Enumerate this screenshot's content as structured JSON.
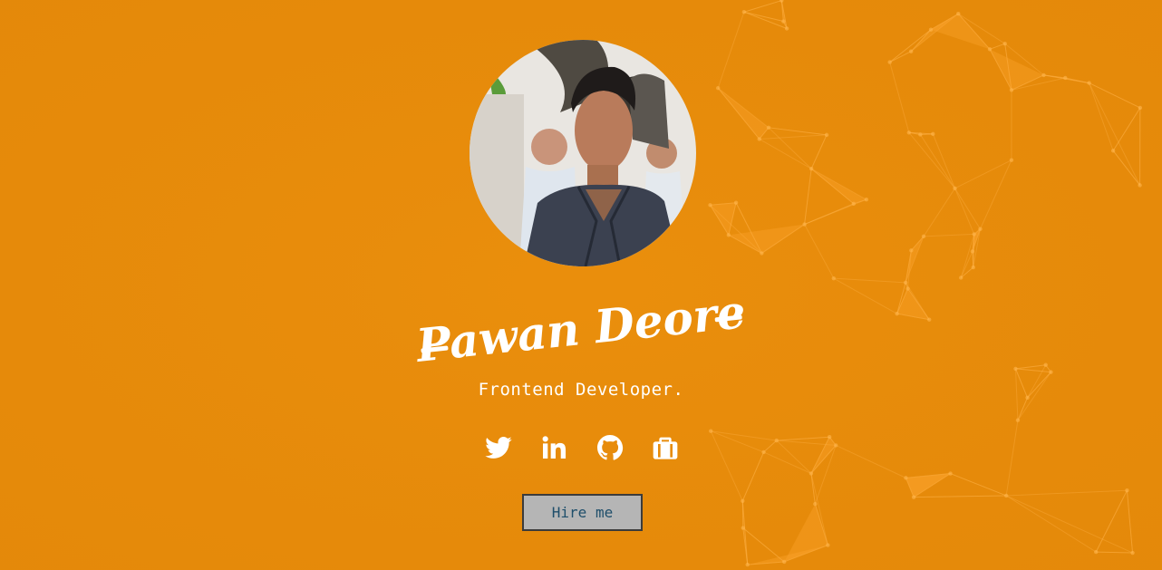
{
  "profile": {
    "name": "Pawan Deore",
    "title": "Frontend Developer.",
    "avatar_alt": "Portrait photo of Pawan Deore"
  },
  "socials": [
    {
      "name": "twitter",
      "icon": "twitter-icon"
    },
    {
      "name": "linkedin",
      "icon": "linkedin-icon"
    },
    {
      "name": "github",
      "icon": "github-icon"
    },
    {
      "name": "portfolio",
      "icon": "briefcase-icon"
    }
  ],
  "cta": {
    "label": "Hire me"
  },
  "colors": {
    "background": "#e88c0b",
    "accent_network": "#ffa630",
    "text": "#ffffff",
    "button_bg": "#b5b5b5",
    "button_text": "#1e4e6a"
  }
}
